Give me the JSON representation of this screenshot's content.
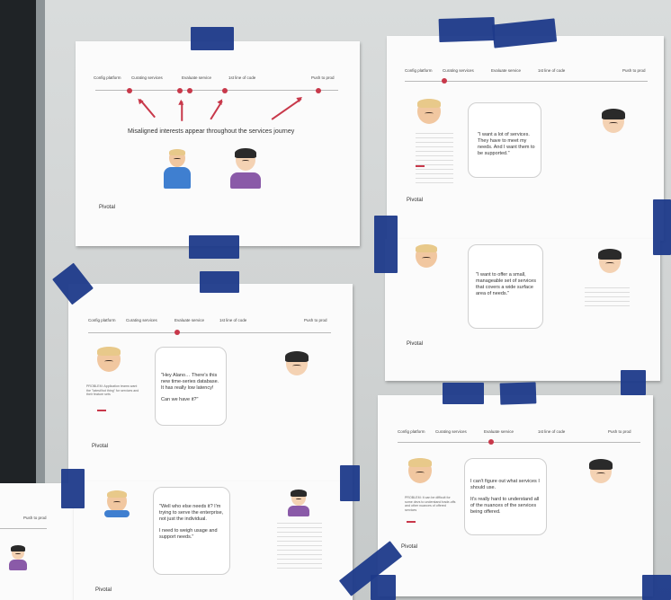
{
  "logo": "Pivotal",
  "stages": {
    "config": "Config platform",
    "curating": "Curating services",
    "evaluate": "Evaluate service",
    "first_line": "1st line of code",
    "push": "Push to prod"
  },
  "sheet1": {
    "headline": "Misaligned interests appear throughout the services journey"
  },
  "sheet2": {
    "quote": "\"I want a lot of services. They have to meet my needs. And I want them to be supported.\""
  },
  "sheet3": {
    "quote": "\"I want to offer a small, manageable set of services that covers a wide surface area of needs.\""
  },
  "sheet4": {
    "quote_line1": "\"Hey Alano… There's this new time-series database. It has really low latency!",
    "quote_line2": "Can we have it?\"",
    "note": "PROBLEM: Application teams want the \"latest/hot thing\" for services and their feature sets"
  },
  "sheet5": {
    "quote_line1": "\"Well who else needs it? I'm trying to serve the enterprise, not just the individual.",
    "quote_line2": "I need to weigh usage and support needs.\""
  },
  "sheet6": {
    "quote_line1": "I can't figure out what services I should use.",
    "quote_line2": "It's really hard to understand all of the nuances of the services being offered.",
    "note": "PROBLEM: It can be difficult for some devs to understand trade-offs and other nuances of offered services"
  },
  "sheet7": {
    "stage": "Push to prod"
  }
}
